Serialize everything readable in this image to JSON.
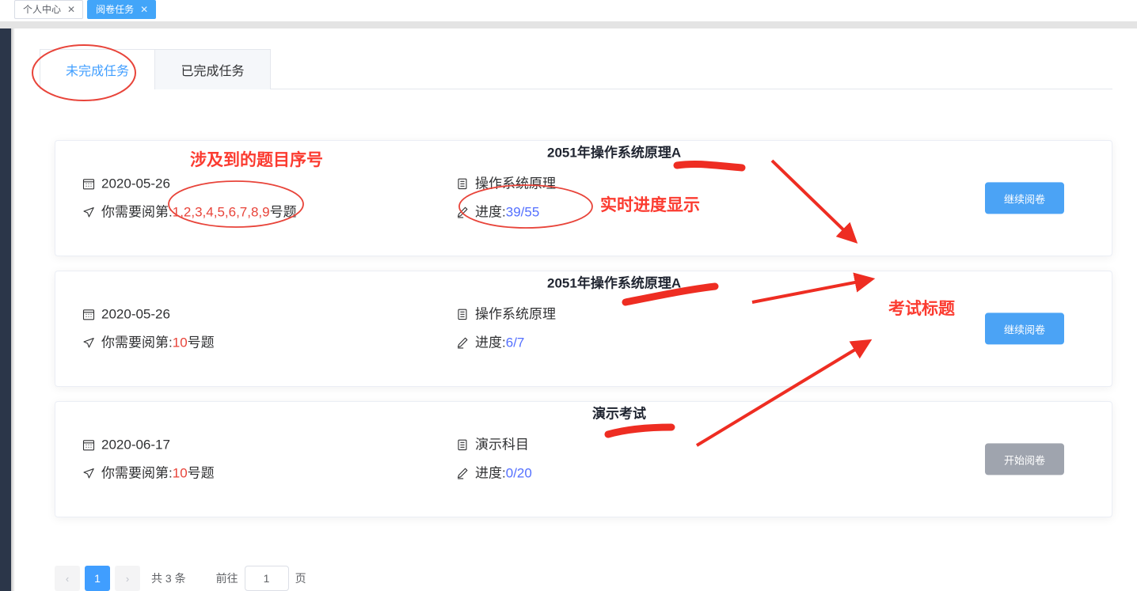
{
  "tagbar": {
    "tabs": [
      {
        "label": "个人中心",
        "close": "✕",
        "active": false
      },
      {
        "label": "阅卷任务",
        "close": "✕",
        "active": true
      }
    ]
  },
  "tabs": {
    "items": [
      {
        "label": "未完成任务",
        "active": true
      },
      {
        "label": "已完成任务",
        "active": false
      }
    ]
  },
  "cards": [
    {
      "date": "2020-05-26",
      "need_prefix": "你需要阅第:",
      "need_numbers": "1,2,3,4,5,6,7,8,9",
      "need_suffix": "号题",
      "course": "操作系统原理",
      "progress_label": "进度:",
      "progress_value": "39/55",
      "exam_title": "2051年操作系统原理A",
      "button_label": "继续阅卷",
      "button_disabled": false
    },
    {
      "date": "2020-05-26",
      "need_prefix": "你需要阅第:",
      "need_numbers": "10",
      "need_suffix": "号题",
      "course": "操作系统原理",
      "progress_label": "进度:",
      "progress_value": "6/7",
      "exam_title": "2051年操作系统原理A",
      "button_label": "继续阅卷",
      "button_disabled": false
    },
    {
      "date": "2020-06-17",
      "need_prefix": "你需要阅第:",
      "need_numbers": "10",
      "need_suffix": "号题",
      "course": "演示科目",
      "progress_label": "进度:",
      "progress_value": "0/20",
      "exam_title": "演示考试",
      "button_label": "开始阅卷",
      "button_disabled": true
    }
  ],
  "pagination": {
    "prev": "‹",
    "next": "›",
    "current_page": "1",
    "total_text": "共 3 条",
    "goto_label": "前往",
    "goto_value": "1",
    "page_unit": "页"
  },
  "annotations": [
    {
      "text": "涉及到的题目序号"
    },
    {
      "text": "实时进度显示"
    },
    {
      "text": "考试标题"
    }
  ],
  "colors": {
    "accent": "#409eff",
    "tag_active": "#42a5f9",
    "button_primary": "#4ba3f5",
    "button_disabled": "#9fa4ae",
    "annotation_red": "#fb3b30",
    "number_red": "#e8443a",
    "number_blue": "#5470ff",
    "rail_dark": "#2b3649"
  }
}
